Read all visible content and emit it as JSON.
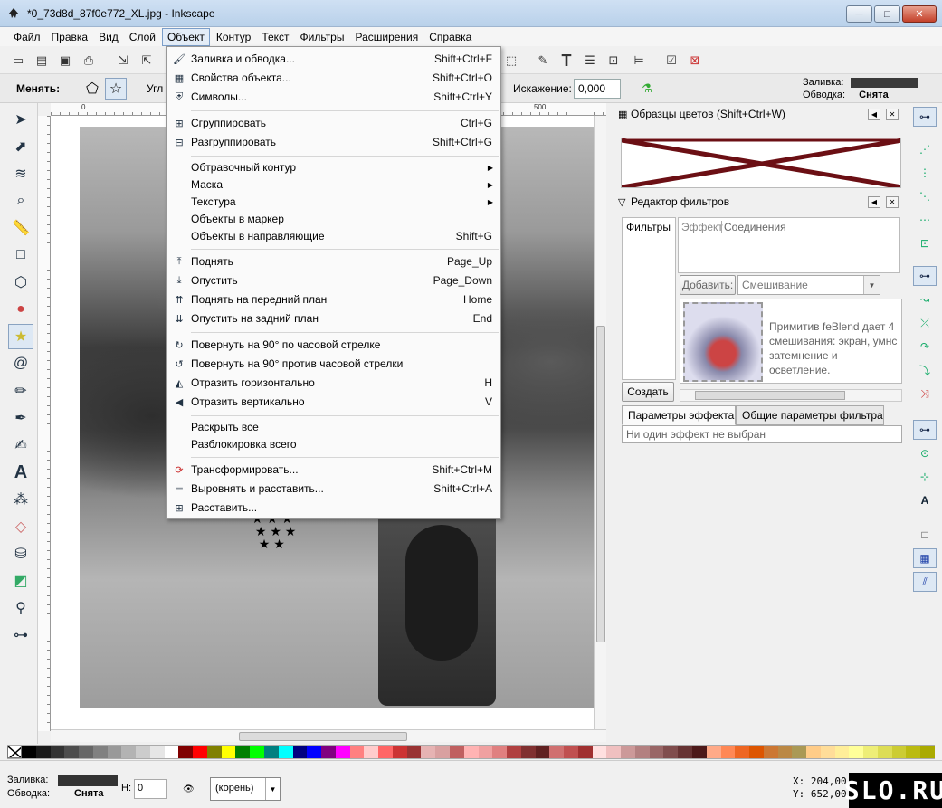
{
  "window": {
    "title": "*0_73d8d_87f0e772_XL.jpg - Inkscape",
    "btn_min": "─",
    "btn_max": "□",
    "btn_close": "✕"
  },
  "menubar": [
    "Файл",
    "Правка",
    "Вид",
    "Слой",
    "Объект",
    "Контур",
    "Текст",
    "Фильтры",
    "Расширения",
    "Справка"
  ],
  "controls": {
    "change_label": "Менять:",
    "angle_label": "Угл",
    "distortion_label": "Искажение:",
    "distortion_value": "0,000",
    "fill_label": "Заливка:",
    "stroke_label": "Обводка:",
    "stroke_value": "Снята"
  },
  "ruler": {
    "t0": "0",
    "t500": "500"
  },
  "object_menu": [
    {
      "label": "Заливка и обводка...",
      "shortcut": "Shift+Ctrl+F",
      "icon": "fill-stroke-icon"
    },
    {
      "label": "Свойства объекта...",
      "shortcut": "Shift+Ctrl+O",
      "icon": "object-properties-icon"
    },
    {
      "label": "Символы...",
      "shortcut": "Shift+Ctrl+Y",
      "icon": "symbols-icon"
    },
    {
      "label": "Сгруппировать",
      "shortcut": "Ctrl+G",
      "icon": "group-icon"
    },
    {
      "label": "Разгруппировать",
      "shortcut": "Shift+Ctrl+G",
      "icon": "ungroup-icon"
    },
    {
      "label": "Обтравочный контур",
      "shortcut": "",
      "icon": ""
    },
    {
      "label": "Маска",
      "shortcut": "",
      "icon": ""
    },
    {
      "label": "Текстура",
      "shortcut": "",
      "icon": ""
    },
    {
      "label": "Объекты в маркер",
      "shortcut": "",
      "icon": ""
    },
    {
      "label": "Объекты в направляющие",
      "shortcut": "Shift+G",
      "icon": ""
    },
    {
      "label": "Поднять",
      "shortcut": "Page_Up",
      "icon": "raise-icon"
    },
    {
      "label": "Опустить",
      "shortcut": "Page_Down",
      "icon": "lower-icon"
    },
    {
      "label": "Поднять на передний план",
      "shortcut": "Home",
      "icon": "raise-to-top-icon"
    },
    {
      "label": "Опустить на задний план",
      "shortcut": "End",
      "icon": "lower-to-bottom-icon"
    },
    {
      "label": "Повернуть на 90° по часовой стрелке",
      "shortcut": "",
      "icon": "rotate-cw-icon"
    },
    {
      "label": "Повернуть на 90° против часовой стрелки",
      "shortcut": "",
      "icon": "rotate-ccw-icon"
    },
    {
      "label": "Отразить горизонтально",
      "shortcut": "H",
      "icon": "flip-horizontal-icon"
    },
    {
      "label": "Отразить вертикально",
      "shortcut": "V",
      "icon": "flip-vertical-icon"
    },
    {
      "label": "Раскрыть все",
      "shortcut": "",
      "icon": ""
    },
    {
      "label": "Разблокировка всего",
      "shortcut": "",
      "icon": ""
    },
    {
      "label": "Трансформировать...",
      "shortcut": "Shift+Ctrl+M",
      "icon": "transform-icon"
    },
    {
      "label": "Выровнять и расставить...",
      "shortcut": "Shift+Ctrl+A",
      "icon": "align-icon"
    },
    {
      "label": "Расставить...",
      "shortcut": "",
      "icon": "arrange-icon"
    }
  ],
  "swatches_panel": {
    "title": "Образцы цветов (Shift+Ctrl+W)"
  },
  "filter_editor": {
    "title": "Редактор фильтров",
    "filters_header": "Фильтры",
    "effect_header": "Эффект",
    "connections_header": "Соединения",
    "add_button": "Добавить:",
    "blend_combo": "Смешивание",
    "blend_desc": "Примитив feBlend дает 4 смешивания: экран, умнс затемнение и осветление.",
    "create_button": "Создать",
    "tab_effect_params": "Параметры эффекта",
    "tab_filter_params": "Общие параметры фильтра",
    "no_effect": "Ни один эффект не выбран"
  },
  "statusbar": {
    "fill_label": "Заливка:",
    "stroke_label": "Обводка:",
    "stroke_value": "Снята",
    "h_label": "H:",
    "h_value": "0",
    "layer": "(корень)",
    "x_line": "X:  204,00",
    "y_line": "Y:  652,00"
  },
  "logo": "SLO.RU",
  "palette_colors": [
    "#000000",
    "#1a1a1a",
    "#333333",
    "#4d4d4d",
    "#666666",
    "#808080",
    "#999999",
    "#b3b3b3",
    "#cccccc",
    "#e6e6e6",
    "#ffffff",
    "#800000",
    "#ff0000",
    "#808000",
    "#ffff00",
    "#008000",
    "#00ff00",
    "#008080",
    "#00ffff",
    "#000080",
    "#0000ff",
    "#800080",
    "#ff00ff",
    "#ff8080",
    "#ffcccc",
    "#ff6666",
    "#cc3333",
    "#993333",
    "#e6b3b3",
    "#d9a0a0",
    "#c06060",
    "#ffb3b3",
    "#f0a0a0",
    "#e08080",
    "#b04040",
    "#803030",
    "#602020",
    "#d07070",
    "#c05050",
    "#a03030",
    "#ffe0e0",
    "#f0c0c0",
    "#cc9999",
    "#b38080",
    "#996666",
    "#804d4d",
    "#663333",
    "#4d1a1a",
    "#ffaa88",
    "#ff8855",
    "#ee6622",
    "#dd5500",
    "#cc7733",
    "#bb8844",
    "#aa9955",
    "#ffcc88",
    "#ffdd99",
    "#ffee99",
    "#ffff99",
    "#eeee77",
    "#dddd55",
    "#cccc33",
    "#bbbb11",
    "#aaaa00"
  ]
}
